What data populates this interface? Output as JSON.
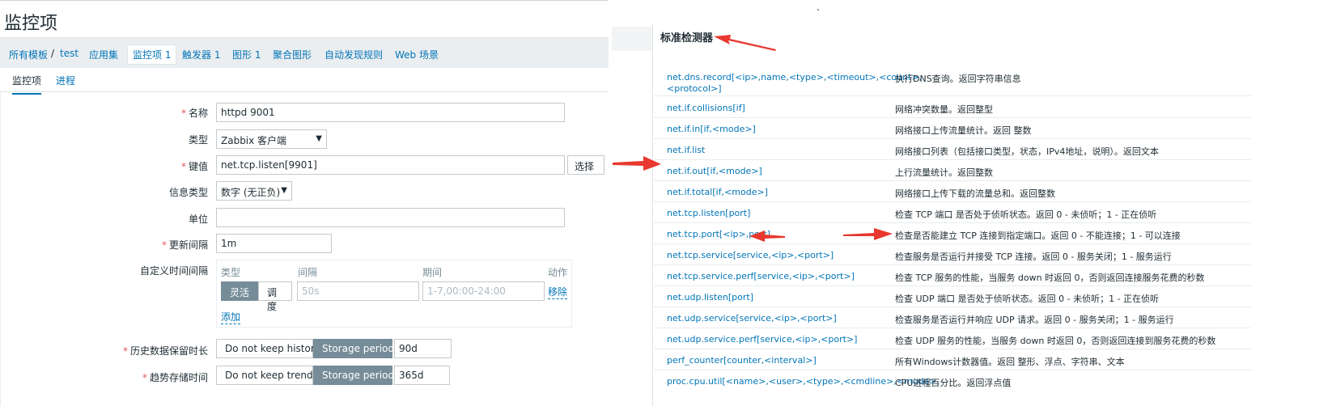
{
  "page_title": "监控项",
  "breadcrumbs": [
    {
      "label": "所有模板"
    },
    {
      "label": "/"
    },
    {
      "label": "test"
    },
    {
      "label": "应用集"
    },
    {
      "label": "监控项 1"
    },
    {
      "label": "触发器 1"
    },
    {
      "label": "图形 1"
    },
    {
      "label": "聚合图形"
    },
    {
      "label": "自动发现规则"
    },
    {
      "label": "Web 场景"
    }
  ],
  "tabs": [
    {
      "label": "监控项"
    },
    {
      "label": "进程"
    }
  ],
  "form": {
    "required_mark": "*",
    "name_label": "名称",
    "name_value": "httpd 9001",
    "type_label": "类型",
    "type_value": "Zabbix 客户端",
    "key_label": "键值",
    "key_value": "net.tcp.listen[9901]",
    "select_button": "选择",
    "info_type_label": "信息类型",
    "info_type_value": "数字 (无正负)",
    "units_label": "单位",
    "units_value": "",
    "interval_label": "更新间隔",
    "interval_value": "1m",
    "custom_intervals_label": "自定义时间间隔",
    "custom": {
      "col_type": "类型",
      "col_interval": "间隔",
      "col_period": "期间",
      "col_action": "动作",
      "flexible": "灵活",
      "scheduling": "调度",
      "interval_placeholder": "50s",
      "period_placeholder": "1-7,00:00-24:00",
      "remove": "移除",
      "add": "添加"
    },
    "history_label": "历史数据保留时长",
    "history_off": "Do not keep history",
    "history_on": "Storage period",
    "history_value": "90d",
    "trends_label": "趋势存储时间",
    "trends_off": "Do not keep trends",
    "trends_on": "Storage period",
    "trends_value": "365d"
  },
  "standard_checks": {
    "title": "标准检测器",
    "rows": [
      {
        "key": "net.dns.record[<ip>,name,<type>,<timeout>,<count>,",
        "key2": "<protocol>]",
        "desc": "执行DNS查询。返回字符串信息"
      },
      {
        "key": "net.if.collisions[if]",
        "desc": "网络冲突数量。返回整型"
      },
      {
        "key": "net.if.in[if,<mode>]",
        "desc": "网络接口上传流量统计。返回 整数"
      },
      {
        "key": "net.if.list",
        "desc": "网络接口列表（包括接口类型，状态，IPv4地址，说明）。返回文本"
      },
      {
        "key": "net.if.out[if,<mode>]",
        "desc": "上行流量统计。返回整数"
      },
      {
        "key": "net.if.total[if,<mode>]",
        "desc": "网络接口上传下载的流量总和。返回整数"
      },
      {
        "key": "net.tcp.listen[port]",
        "desc": "检查 TCP 端口 是否处于侦听状态。返回 0 - 未侦听；1 - 正在侦听"
      },
      {
        "key": "net.tcp.port[<ip>,port]",
        "desc": "检查是否能建立 TCP 连接到指定端口。返回 0 - 不能连接；1 - 可以连接"
      },
      {
        "key": "net.tcp.service[service,<ip>,<port>]",
        "desc": "检查服务是否运行并接受 TCP 连接。返回 0 - 服务关闭；1 - 服务运行"
      },
      {
        "key": "net.tcp.service.perf[service,<ip>,<port>]",
        "desc": "检查 TCP 服务的性能，当服务 down 时返回 0，否则返回连接服务花费的秒数"
      },
      {
        "key": "net.udp.listen[port]",
        "desc": "检查 UDP 端口 是否处于侦听状态。返回 0 - 未侦听；1 - 正在侦听"
      },
      {
        "key": "net.udp.service[service,<ip>,<port>]",
        "desc": "检查服务是否运行并响应 UDP 请求。返回 0 - 服务关闭；1 - 服务运行"
      },
      {
        "key": "net.udp.service.perf[service,<ip>,<port>]",
        "desc": "检查 UDP 服务的性能，当服务 down 时返回 0，否则返回连接到服务花费的秒数"
      },
      {
        "key": "perf_counter[counter,<interval>]",
        "desc": "所有Windows计数器值。返回 整形、浮点、字符串、文本"
      },
      {
        "key": "proc.cpu.util[<name>,<user>,<type>,<cmdline>,<mode>,",
        "desc": "CPU进程百分比。返回浮点值"
      }
    ]
  },
  "colors": {
    "link": "#0275b8",
    "active_segment": "#768d99",
    "required": "#e45959",
    "annotation_arrow": "#e8382f"
  }
}
